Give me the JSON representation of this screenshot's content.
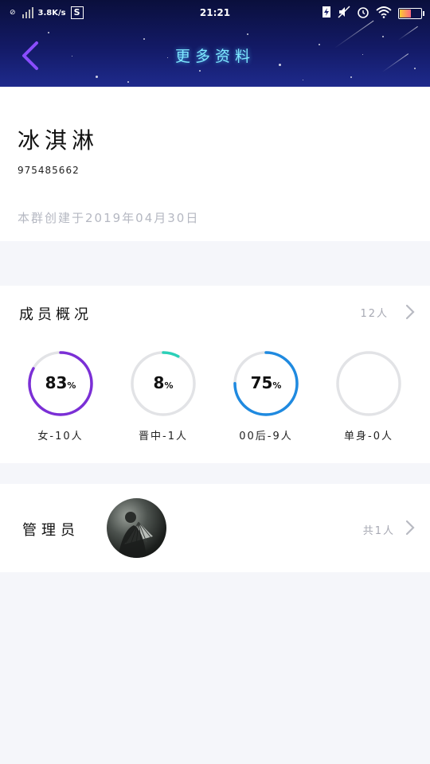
{
  "status_bar": {
    "speed": "3.8K/s",
    "s_badge": "S",
    "time": "21:21"
  },
  "nav": {
    "title": "更多资料"
  },
  "group": {
    "name": "冰淇淋",
    "id": "975485662",
    "created": "本群创建于2019年04月30日"
  },
  "members": {
    "title": "成员概况",
    "count": "12人",
    "stats": [
      {
        "value": "83",
        "unit": "%",
        "label": "女-10人",
        "percent": 83,
        "color": "#7b2fd6"
      },
      {
        "value": "8",
        "unit": "%",
        "label": "晋中-1人",
        "percent": 8,
        "color": "#2bd0b8"
      },
      {
        "value": "75",
        "unit": "%",
        "label": "00后-9人",
        "percent": 75,
        "color": "#1f8ae0"
      },
      {
        "value": "",
        "unit": "",
        "label": "单身-0人",
        "percent": 0,
        "color": "#dddddd"
      }
    ]
  },
  "admin": {
    "title": "管理员",
    "count": "共1人"
  },
  "colors": {
    "ring_track": "#e2e3e6",
    "header_top": "#0a0f3c",
    "title_glow": "#7ee8ff",
    "back_arrow": "#8a4dff"
  }
}
